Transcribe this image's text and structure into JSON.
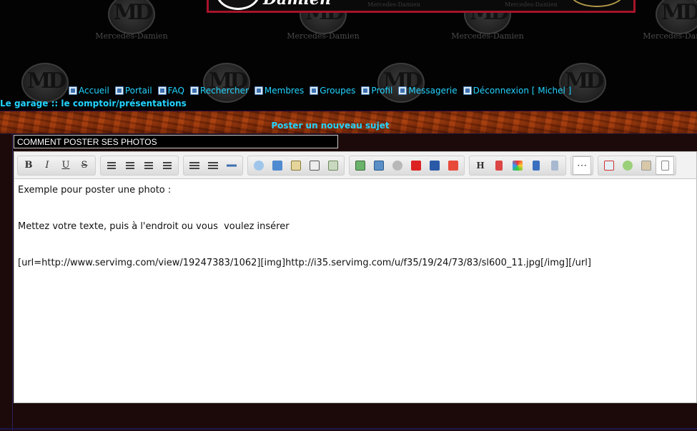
{
  "header": {
    "watermark_caption": "Mercedes-Damien",
    "watermark_monogram": "MD",
    "banner_text": "Damien",
    "banner_small_caption": "Mercedes-Damien"
  },
  "nav": {
    "items": [
      {
        "label": "Accueil",
        "icon": "home-icon"
      },
      {
        "label": "Portail",
        "icon": "portal-icon"
      },
      {
        "label": "FAQ",
        "icon": "faq-icon"
      },
      {
        "label": "Rechercher",
        "icon": "search-icon"
      },
      {
        "label": "Membres",
        "icon": "members-icon"
      },
      {
        "label": "Groupes",
        "icon": "groups-icon"
      },
      {
        "label": "Profil",
        "icon": "profile-icon"
      },
      {
        "label": "Messagerie",
        "icon": "mail-icon"
      },
      {
        "label": "Déconnexion [ Michel ]",
        "icon": "logout-icon"
      }
    ]
  },
  "breadcrumb": {
    "part1": "Le garage",
    "separator": "::",
    "part2": "le comptoir/présentations"
  },
  "form": {
    "title": "Poster un nouveau sujet",
    "subject_value": "COMMENT POSTER SES PHOTOS"
  },
  "toolbar": {
    "bold": "B",
    "italic": "I",
    "underline": "U",
    "strike": "S",
    "heading": "H"
  },
  "editor": {
    "line1": "Exemple pour poster une photo :",
    "line2": "Mettez votre texte, puis à l'endroit ou vous  voulez insérer",
    "line3": "[url=http://www.servimg.com/view/19247383/1062][img]http://i35.servimg.com/u/f35/19/24/73/83/sl600_11.jpg[/img][/url]"
  },
  "colors": {
    "link": "#22d4ff",
    "banner_border": "#a6142a",
    "wood": "#9e3a0e",
    "panel": "#1c0a0a"
  }
}
